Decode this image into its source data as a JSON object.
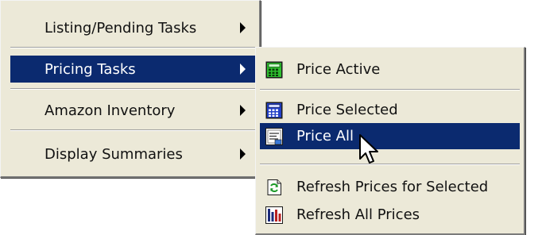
{
  "main_menu": {
    "items": [
      {
        "label": "Listing/Pending Tasks",
        "icon": "submenu-arrow-icon"
      },
      {
        "label": "Pricing Tasks",
        "icon": "submenu-arrow-icon",
        "highlighted": true
      },
      {
        "label": "Amazon Inventory",
        "icon": "submenu-arrow-icon"
      },
      {
        "label": "Display Summaries",
        "icon": "submenu-arrow-icon"
      }
    ]
  },
  "pricing_submenu": {
    "items": [
      {
        "label": "Price Active",
        "icon": "calculator-green-icon"
      },
      {
        "label": "Price Selected",
        "icon": "calculator-blue-icon"
      },
      {
        "label": "Price All",
        "icon": "price-list-icon",
        "highlighted": true
      },
      {
        "label": "Refresh Prices for Selected",
        "icon": "refresh-icon"
      },
      {
        "label": "Refresh All Prices",
        "icon": "bar-chart-icon"
      }
    ]
  },
  "colors": {
    "menu_background": "#ece9d8",
    "highlight": "#0b2a6f",
    "highlight_text": "#ffffff",
    "text": "#111111"
  },
  "cursor": {
    "icon": "mouse-pointer-icon"
  }
}
